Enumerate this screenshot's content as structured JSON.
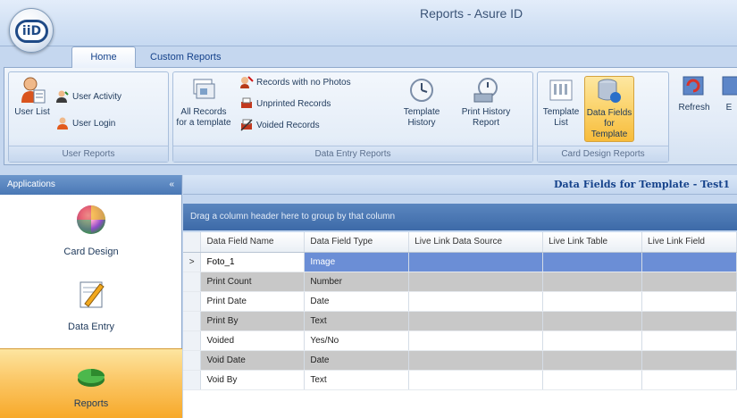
{
  "window": {
    "title": "Reports - Asure ID",
    "logo_text": "iiD"
  },
  "tabs": [
    {
      "label": "Home"
    },
    {
      "label": "Custom Reports"
    }
  ],
  "ribbon": {
    "user_reports": {
      "label": "User Reports",
      "user_list": "User List",
      "user_activity": "User Activity",
      "user_login": "User Login"
    },
    "data_entry_reports": {
      "label": "Data Entry Reports",
      "all_records": "All Records for a template",
      "records_no_photos": "Records with no Photos",
      "unprinted_records": "Unprinted Records",
      "voided_records": "Voided Records",
      "template_history": "Template History",
      "print_history": "Print History Report"
    },
    "card_design_reports": {
      "label": "Card Design Reports",
      "template_list": "Template List",
      "data_fields": "Data Fields for Template"
    },
    "refresh": "Refresh",
    "export": "E"
  },
  "nav": {
    "header": "Applications",
    "chevron": "«",
    "items": [
      {
        "label": "Card Design"
      },
      {
        "label": "Data Entry"
      },
      {
        "label": "Reports"
      }
    ]
  },
  "main": {
    "title": "Data Fields for Template - Test1",
    "group_hint": "Drag a column header here to group by that column",
    "columns": [
      "Data Field Name",
      "Data Field Type",
      "Live Link Data Source",
      "Live Link Table",
      "Live Link Field"
    ],
    "current_row_marker": ">",
    "rows": [
      {
        "name": "Foto_1",
        "type": "Image"
      },
      {
        "name": "Print Count",
        "type": "Number"
      },
      {
        "name": "Print Date",
        "type": "Date"
      },
      {
        "name": "Print By",
        "type": "Text"
      },
      {
        "name": "Voided",
        "type": "Yes/No"
      },
      {
        "name": "Void Date",
        "type": "Date"
      },
      {
        "name": "Void By",
        "type": "Text"
      }
    ]
  }
}
